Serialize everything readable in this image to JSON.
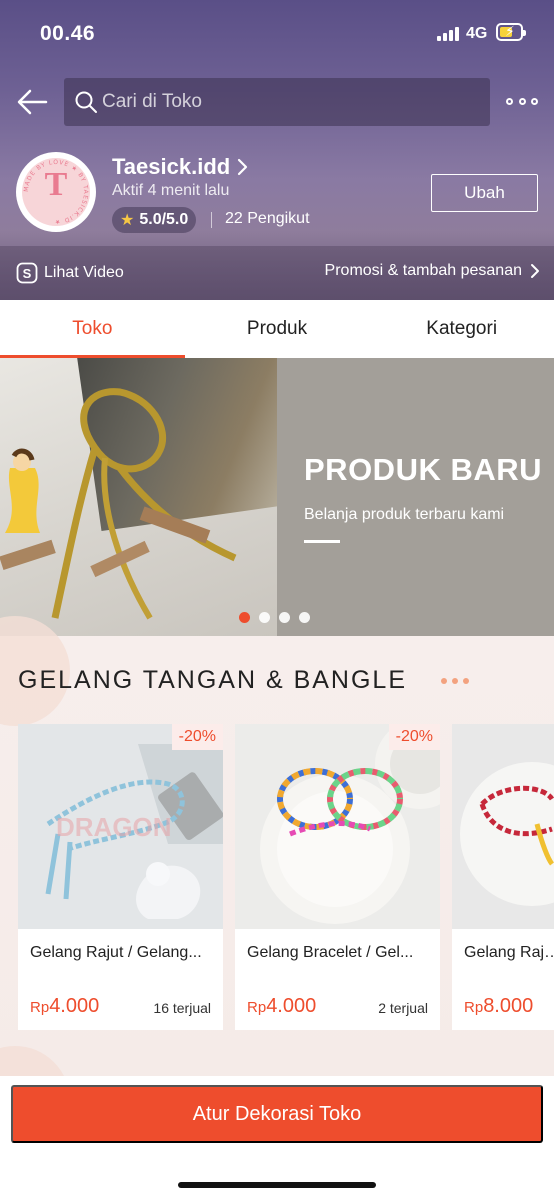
{
  "status_bar": {
    "time": "00.46",
    "network": "4G"
  },
  "search": {
    "placeholder": "Cari di Toko"
  },
  "shop": {
    "name": "Taesick.idd",
    "status": "Aktif 4 menit lalu",
    "rating": "5.0/5.0",
    "followers": "22 Pengikut",
    "edit_label": "Ubah",
    "avatar_letter": "T",
    "avatar_ring_text": "MADE BY LOVE ★ BY TAESICK.ID ★"
  },
  "links": {
    "video": "Lihat Video",
    "promo": "Promosi & tambah pesanan"
  },
  "tabs": [
    {
      "label": "Toko",
      "active": true
    },
    {
      "label": "Produk",
      "active": false
    },
    {
      "label": "Kategori",
      "active": false
    }
  ],
  "banner": {
    "title": "PRODUK BARU",
    "subtitle": "Belanja produk terbaru kami",
    "slides": 4,
    "active_slide": 1
  },
  "section": {
    "title": "GELANG TANGAN & BANGLE",
    "products": [
      {
        "name": "Gelang Rajut / Gelang...",
        "currency": "Rp",
        "price": "4.000",
        "sold": "16 terjual",
        "discount": "-20%"
      },
      {
        "name": "Gelang Bracelet / Gel...",
        "currency": "Rp",
        "price": "4.000",
        "sold": "2 terjual",
        "discount": "-20%"
      },
      {
        "name": "Gelang Rajut...",
        "currency": "Rp",
        "price": "8.000",
        "sold": "",
        "discount": ""
      }
    ]
  },
  "cta": {
    "label": "Atur Dekorasi Toko"
  },
  "colors": {
    "accent": "#ee4d2d",
    "header": "#6e6194",
    "star": "#f6c745"
  }
}
